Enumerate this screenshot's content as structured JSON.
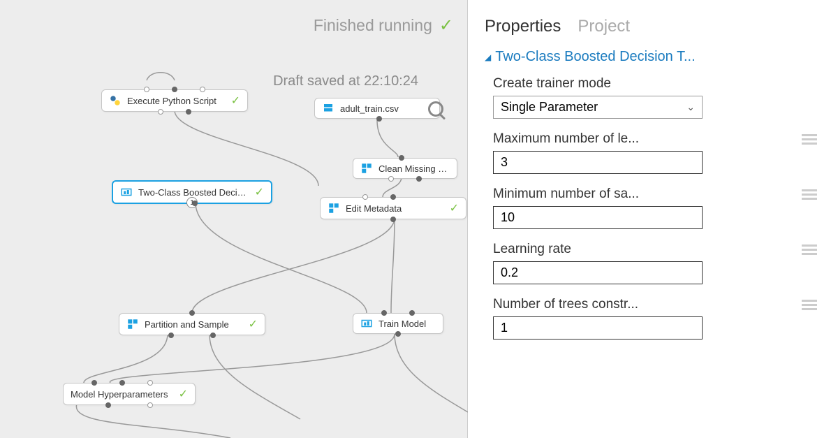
{
  "status": {
    "text": "Finished running"
  },
  "draft": {
    "text": "Draft saved at 22:10:24"
  },
  "nodes": {
    "exec_python": {
      "label": "Execute Python Script"
    },
    "adult_train": {
      "label": "adult_train.csv"
    },
    "two_class": {
      "label": "Two-Class Boosted Decision...",
      "badge": "1"
    },
    "clean_missing": {
      "label": "Clean Missing Data"
    },
    "edit_metadata": {
      "label": "Edit Metadata"
    },
    "partition": {
      "label": "Partition and Sample"
    },
    "train_model": {
      "label": "Train Model"
    },
    "tune_hyper": {
      "label": "Model Hyperparameters"
    }
  },
  "tabs": {
    "properties": "Properties",
    "project": "Project"
  },
  "section": {
    "title": "Two-Class Boosted Decision T..."
  },
  "fields": {
    "trainer_mode": {
      "label": "Create trainer mode",
      "value": "Single Parameter"
    },
    "max_leaves": {
      "label": "Maximum number of le...",
      "value": "3"
    },
    "min_samples": {
      "label": "Minimum number of sa...",
      "value": "10"
    },
    "learning_rate": {
      "label": "Learning rate",
      "value": "0.2"
    },
    "num_trees": {
      "label": "Number of trees constr...",
      "value": "1"
    }
  }
}
